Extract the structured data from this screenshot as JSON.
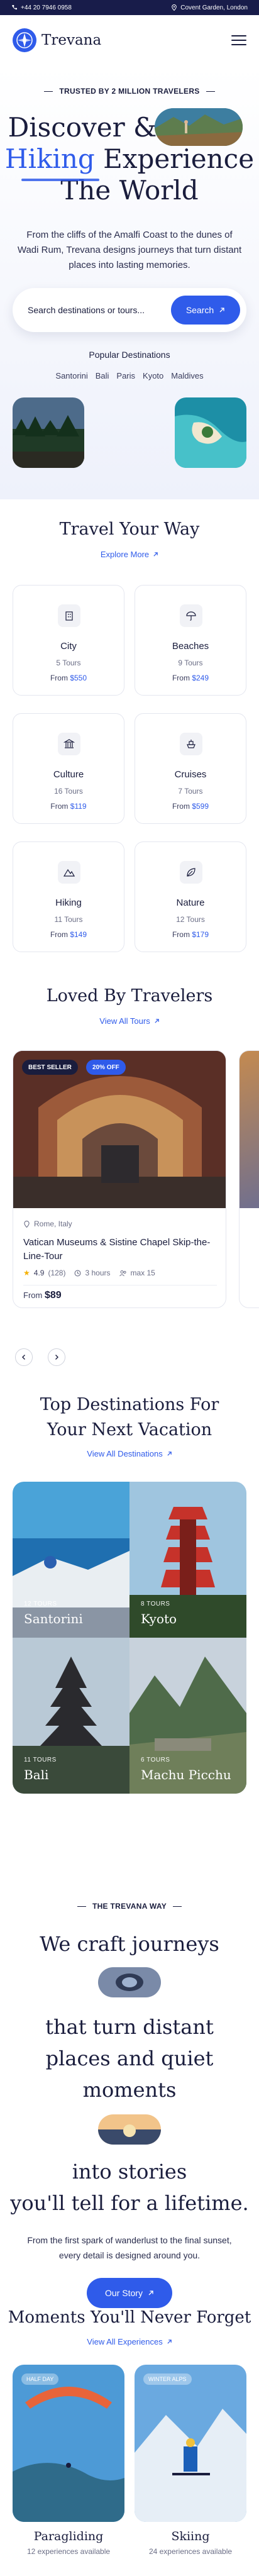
{
  "topbar": {
    "phone": "+44 20 7946 0958",
    "location": "Covent Garden, London"
  },
  "header": {
    "brand": "Trevana"
  },
  "hero": {
    "eyebrow": "TRUSTED BY 2 MILLION TRAVELERS",
    "title_line1": "Discover &",
    "title_highlight": "Hiking",
    "title_line2_rest": "Experience",
    "title_line3": "The World",
    "subtitle": "From the cliffs of the Amalfi Coast to the dunes of Wadi Rum, Trevana designs journeys that turn distant places into lasting memories.",
    "search_placeholder": "Search destinations or tours...",
    "search_button": "Search",
    "popular_title": "Popular Destinations",
    "popular": [
      "Santorini",
      "Bali",
      "Paris",
      "Kyoto",
      "Maldives"
    ]
  },
  "travel_way": {
    "title": "Travel Your Way",
    "link": "Explore More",
    "categories": [
      {
        "name": "City",
        "count": "5 Tours",
        "from_label": "From",
        "price": "$550",
        "icon": "building-icon"
      },
      {
        "name": "Beaches",
        "count": "9 Tours",
        "from_label": "From",
        "price": "$249",
        "icon": "umbrella-icon"
      },
      {
        "name": "Culture",
        "count": "16 Tours",
        "from_label": "From",
        "price": "$119",
        "icon": "temple-icon"
      },
      {
        "name": "Cruises",
        "count": "7 Tours",
        "from_label": "From",
        "price": "$599",
        "icon": "ship-icon"
      },
      {
        "name": "Hiking",
        "count": "11 Tours",
        "from_label": "From",
        "price": "$149",
        "icon": "mountain-icon"
      },
      {
        "name": "Nature",
        "count": "12 Tours",
        "from_label": "From",
        "price": "$179",
        "icon": "leaf-icon"
      }
    ]
  },
  "loved": {
    "title": "Loved By Travelers",
    "link": "View All Tours",
    "tour": {
      "badge_best": "BEST SELLER",
      "badge_off": "20% OFF",
      "location": "Rome, Italy",
      "title": "Vatican Museums & Sistine Chapel Skip-the-Line-Tour",
      "rating": "4.9",
      "reviews": "(128)",
      "duration": "3 hours",
      "group": "max 15",
      "from_label": "From",
      "price": "$89"
    }
  },
  "top_destinations": {
    "title": "Top Destinations For Your Next Vacation",
    "link": "View All Destinations",
    "items": [
      {
        "tours": "12 TOURS",
        "name": "Santorini"
      },
      {
        "tours": "8 TOURS",
        "name": "Kyoto"
      },
      {
        "tours": "11 TOURS",
        "name": "Bali"
      },
      {
        "tours": "6 TOURS",
        "name": "Machu Picchu"
      }
    ]
  },
  "story": {
    "eyebrow": "THE TREVANA WAY",
    "line1": "We craft journeys",
    "line2": "that turn distant",
    "line3": "places and quiet",
    "line4": "moments",
    "line5": "into stories",
    "line6": "you'll tell for a lifetime.",
    "paragraph": "From the first spark of wanderlust to the final sunset, every detail is designed around you.",
    "cta": "Our Story"
  },
  "moments": {
    "title": "Moments You'll Never Forget",
    "link": "View All Experiences",
    "items": [
      {
        "chip": "HALF DAY",
        "name": "Paragliding",
        "count": "12 experiences available"
      },
      {
        "chip": "WINTER ALPS",
        "name": "Skiing",
        "count": "24 experiences available"
      }
    ]
  },
  "colors": {
    "primary": "#2f5bea",
    "navy": "#181c4a",
    "text": "#1a1d3d"
  }
}
